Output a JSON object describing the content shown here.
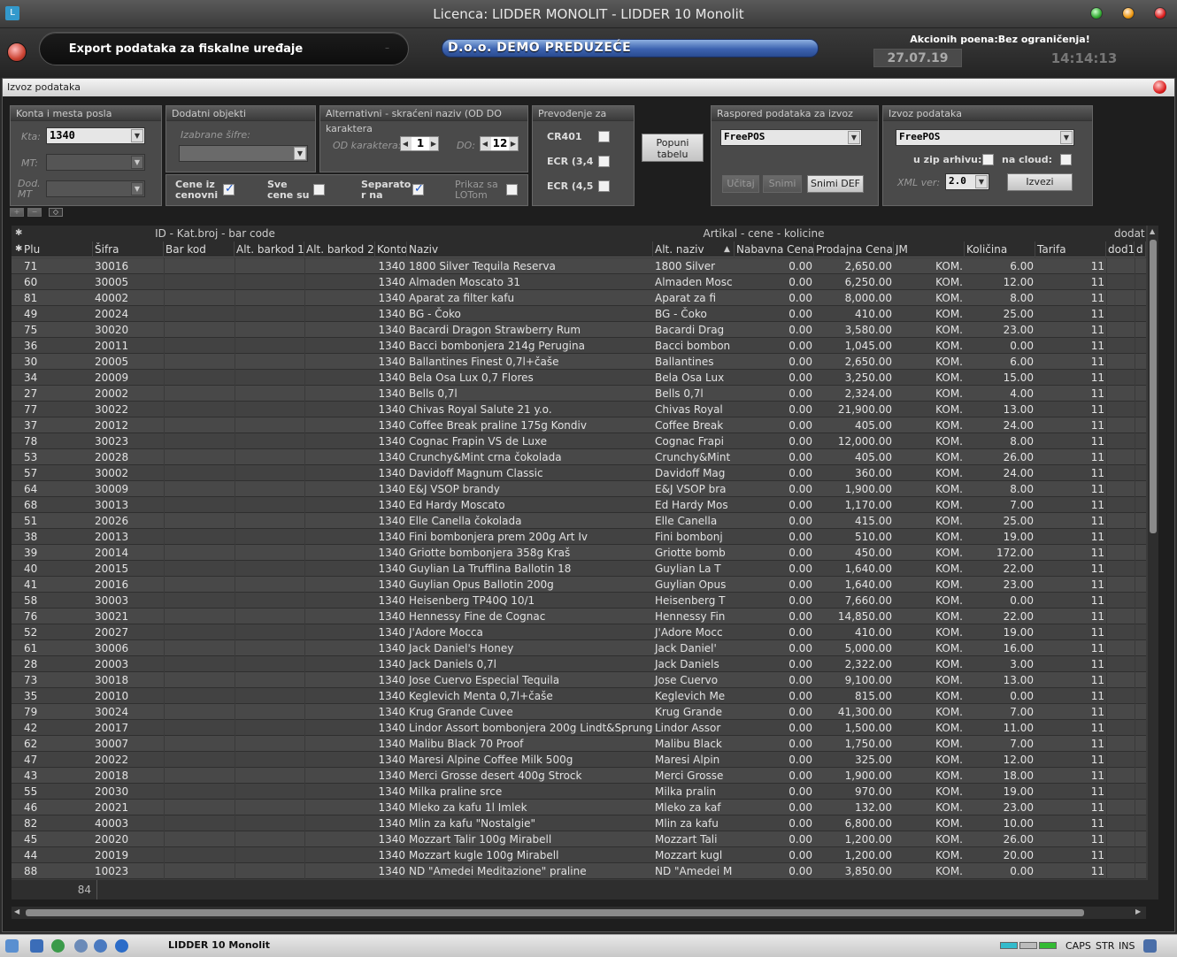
{
  "window": {
    "title": "Licenca: LIDDER MONOLIT - LIDDER 10 Monolit"
  },
  "header": {
    "module": "Export podataka za fiskalne uređaje",
    "company": "D.o.o. DEMO PREDUZEĆE",
    "akcioni": "Akcionih poena:Bez ograničenja!",
    "date": "27.07.19",
    "time": "14:14:13"
  },
  "subwindow": {
    "title": "Izvoz podataka"
  },
  "panels": {
    "konta": {
      "title": "Konta i mesta posla",
      "kta_label": "Kta:",
      "kta_value": "1340",
      "mt_label": "MT:",
      "dod_label": "Dod. MT"
    },
    "dodatni": {
      "title": "Dodatni objekti",
      "sifre_label": "Izabrane šifre:"
    },
    "alt": {
      "title": "Alternativni - skraćeni naziv (OD DO karaktera",
      "od_label": "OD karaktera:",
      "od_value": "1",
      "do_label": "DO:",
      "do_value": "12"
    },
    "checks": {
      "cene_iz": "Cene iz cenovni",
      "sve_cene": "Sve cene su",
      "separator": "Separato r na",
      "prikaz": "Prikaz sa LOTom"
    },
    "prevodjenje": {
      "title": "Prevođenje za",
      "items": [
        "CR401",
        "ECR (3,4",
        "ECR (4,5"
      ]
    },
    "popuni": "Popuni tabelu",
    "raspored": {
      "title": "Raspored podataka za izvoz",
      "value": "FreePOS",
      "ucitaj": "Učitaj",
      "snimi": "Snimi",
      "snimi_def": "Snimi DEF"
    },
    "izvoz": {
      "title": "Izvoz podataka",
      "value": "FreePOS",
      "zip": "u zip arhivu:",
      "cloud": "na cloud:",
      "xml_label": "XML ver:",
      "xml_value": "2.0",
      "izvezi": "Izvezi"
    }
  },
  "grid": {
    "band1": "ID - Kat.broj - bar code",
    "band2": "Artikal - cene - kolicine",
    "band3": "dodat",
    "columns": [
      "Plu",
      "Šifra",
      "Bar kod",
      "Alt. barkod 1",
      "Alt. barkod 2",
      "Konto",
      "Naziv",
      "Alt. naziv",
      "Nabavna Cena",
      "Prodajna Cena",
      "JM",
      "Količina",
      "Tarifa",
      "dod1",
      "d"
    ],
    "rows": [
      [
        "71",
        "30016",
        "1340",
        "1800 Silver Tequila Reserva",
        "1800 Silver",
        "0.00",
        "2,650.00",
        "KOM.",
        "6.00",
        "11"
      ],
      [
        "60",
        "30005",
        "1340",
        "Almaden Moscato 31",
        "Almaden Mosc",
        "0.00",
        "6,250.00",
        "KOM.",
        "12.00",
        "11"
      ],
      [
        "81",
        "40002",
        "1340",
        "Aparat za filter kafu",
        "Aparat za fi",
        "0.00",
        "8,000.00",
        "KOM.",
        "8.00",
        "11"
      ],
      [
        "49",
        "20024",
        "1340",
        "BG - Čoko",
        "BG - Čoko",
        "0.00",
        "410.00",
        "KOM.",
        "25.00",
        "11"
      ],
      [
        "75",
        "30020",
        "1340",
        "Bacardi Dragon Strawberry Rum",
        "Bacardi Drag",
        "0.00",
        "3,580.00",
        "KOM.",
        "23.00",
        "11"
      ],
      [
        "36",
        "20011",
        "1340",
        "Bacci bombonjera 214g Perugina",
        "Bacci bombon",
        "0.00",
        "1,045.00",
        "KOM.",
        "0.00",
        "11"
      ],
      [
        "30",
        "20005",
        "1340",
        "Ballantines Finest 0,7l+čaše",
        "Ballantines",
        "0.00",
        "2,650.00",
        "KOM.",
        "6.00",
        "11"
      ],
      [
        "34",
        "20009",
        "1340",
        "Bela Osa Lux 0,7 Flores",
        "Bela Osa Lux",
        "0.00",
        "3,250.00",
        "KOM.",
        "15.00",
        "11"
      ],
      [
        "27",
        "20002",
        "1340",
        "Bells 0,7l",
        "Bells 0,7l",
        "0.00",
        "2,324.00",
        "KOM.",
        "4.00",
        "11"
      ],
      [
        "77",
        "30022",
        "1340",
        "Chivas Royal Salute 21 y.o.",
        "Chivas Royal",
        "0.00",
        "21,900.00",
        "KOM.",
        "13.00",
        "11"
      ],
      [
        "37",
        "20012",
        "1340",
        "Coffee Break praline 175g Kondiv",
        "Coffee Break",
        "0.00",
        "405.00",
        "KOM.",
        "24.00",
        "11"
      ],
      [
        "78",
        "30023",
        "1340",
        "Cognac Frapin VS de Luxe",
        "Cognac Frapi",
        "0.00",
        "12,000.00",
        "KOM.",
        "8.00",
        "11"
      ],
      [
        "53",
        "20028",
        "1340",
        "Crunchy&Mint crna čokolada",
        "Crunchy&Mint",
        "0.00",
        "405.00",
        "KOM.",
        "26.00",
        "11"
      ],
      [
        "57",
        "30002",
        "1340",
        "Davidoff Magnum Classic",
        "Davidoff Mag",
        "0.00",
        "360.00",
        "KOM.",
        "24.00",
        "11"
      ],
      [
        "64",
        "30009",
        "1340",
        "E&J VSOP brandy",
        "E&J VSOP bra",
        "0.00",
        "1,900.00",
        "KOM.",
        "8.00",
        "11"
      ],
      [
        "68",
        "30013",
        "1340",
        "Ed Hardy Moscato",
        "Ed Hardy Mos",
        "0.00",
        "1,170.00",
        "KOM.",
        "7.00",
        "11"
      ],
      [
        "51",
        "20026",
        "1340",
        "Elle Canella čokolada",
        "Elle Canella",
        "0.00",
        "415.00",
        "KOM.",
        "25.00",
        "11"
      ],
      [
        "38",
        "20013",
        "1340",
        "Fini bombonjera prem 200g Art Iv",
        "Fini bombonj",
        "0.00",
        "510.00",
        "KOM.",
        "19.00",
        "11"
      ],
      [
        "39",
        "20014",
        "1340",
        "Griotte bombonjera 358g Kraš",
        "Griotte bomb",
        "0.00",
        "450.00",
        "KOM.",
        "172.00",
        "11"
      ],
      [
        "40",
        "20015",
        "1340",
        "Guylian La Trufflina Ballotin 18",
        "Guylian La T",
        "0.00",
        "1,640.00",
        "KOM.",
        "22.00",
        "11"
      ],
      [
        "41",
        "20016",
        "1340",
        "Guylian Opus Ballotin 200g",
        "Guylian Opus",
        "0.00",
        "1,640.00",
        "KOM.",
        "23.00",
        "11"
      ],
      [
        "58",
        "30003",
        "1340",
        "Heisenberg TP40Q 10/1",
        "Heisenberg T",
        "0.00",
        "7,660.00",
        "KOM.",
        "0.00",
        "11"
      ],
      [
        "76",
        "30021",
        "1340",
        "Hennessy Fine de Cognac",
        "Hennessy Fin",
        "0.00",
        "14,850.00",
        "KOM.",
        "22.00",
        "11"
      ],
      [
        "52",
        "20027",
        "1340",
        "J'Adore Mocca",
        "J'Adore Mocc",
        "0.00",
        "410.00",
        "KOM.",
        "19.00",
        "11"
      ],
      [
        "61",
        "30006",
        "1340",
        "Jack Daniel's Honey",
        "Jack Daniel'",
        "0.00",
        "5,000.00",
        "KOM.",
        "16.00",
        "11"
      ],
      [
        "28",
        "20003",
        "1340",
        "Jack Daniels 0,7l",
        "Jack Daniels",
        "0.00",
        "2,322.00",
        "KOM.",
        "3.00",
        "11"
      ],
      [
        "73",
        "30018",
        "1340",
        "Jose Cuervo Especial Tequila",
        "Jose Cuervo",
        "0.00",
        "9,100.00",
        "KOM.",
        "13.00",
        "11"
      ],
      [
        "35",
        "20010",
        "1340",
        "Keglevich Menta 0,7l+čaše",
        "Keglevich Me",
        "0.00",
        "815.00",
        "KOM.",
        "0.00",
        "11"
      ],
      [
        "79",
        "30024",
        "1340",
        "Krug Grande Cuvee",
        "Krug Grande",
        "0.00",
        "41,300.00",
        "KOM.",
        "7.00",
        "11"
      ],
      [
        "42",
        "20017",
        "1340",
        "Lindor Assort bombonjera 200g Lindt&Sprungli",
        "Lindor Assor",
        "0.00",
        "1,500.00",
        "KOM.",
        "11.00",
        "11"
      ],
      [
        "62",
        "30007",
        "1340",
        "Malibu Black 70 Proof",
        "Malibu Black",
        "0.00",
        "1,750.00",
        "KOM.",
        "7.00",
        "11"
      ],
      [
        "47",
        "20022",
        "1340",
        "Maresi Alpine Coffee Milk 500g",
        "Maresi Alpin",
        "0.00",
        "325.00",
        "KOM.",
        "12.00",
        "11"
      ],
      [
        "43",
        "20018",
        "1340",
        "Merci Grosse desert 400g Strock",
        "Merci Grosse",
        "0.00",
        "1,900.00",
        "KOM.",
        "18.00",
        "11"
      ],
      [
        "55",
        "20030",
        "1340",
        "Milka praline srce",
        "Milka pralin",
        "0.00",
        "970.00",
        "KOM.",
        "19.00",
        "11"
      ],
      [
        "46",
        "20021",
        "1340",
        "Mleko za kafu 1l Imlek",
        "Mleko za kaf",
        "0.00",
        "132.00",
        "KOM.",
        "23.00",
        "11"
      ],
      [
        "82",
        "40003",
        "1340",
        "Mlin za kafu \"Nostalgie\"",
        "Mlin za kafu",
        "0.00",
        "6,800.00",
        "KOM.",
        "10.00",
        "11"
      ],
      [
        "45",
        "20020",
        "1340",
        "Mozzart Talir 100g Mirabell",
        "Mozzart Tali",
        "0.00",
        "1,200.00",
        "KOM.",
        "26.00",
        "11"
      ],
      [
        "44",
        "20019",
        "1340",
        "Mozzart kugle 100g Mirabell",
        "Mozzart kugl",
        "0.00",
        "1,200.00",
        "KOM.",
        "20.00",
        "11"
      ],
      [
        "88",
        "10023",
        "1340",
        "ND \"Amedei Meditazione\" praline",
        "ND \"Amedei M",
        "0.00",
        "3,850.00",
        "KOM.",
        "0.00",
        "11"
      ]
    ],
    "footer_count": "84"
  },
  "statusbar": {
    "app": "LIDDER 10 Monolit",
    "caps": "CAPS",
    "str": "STR",
    "ins": "INS"
  }
}
